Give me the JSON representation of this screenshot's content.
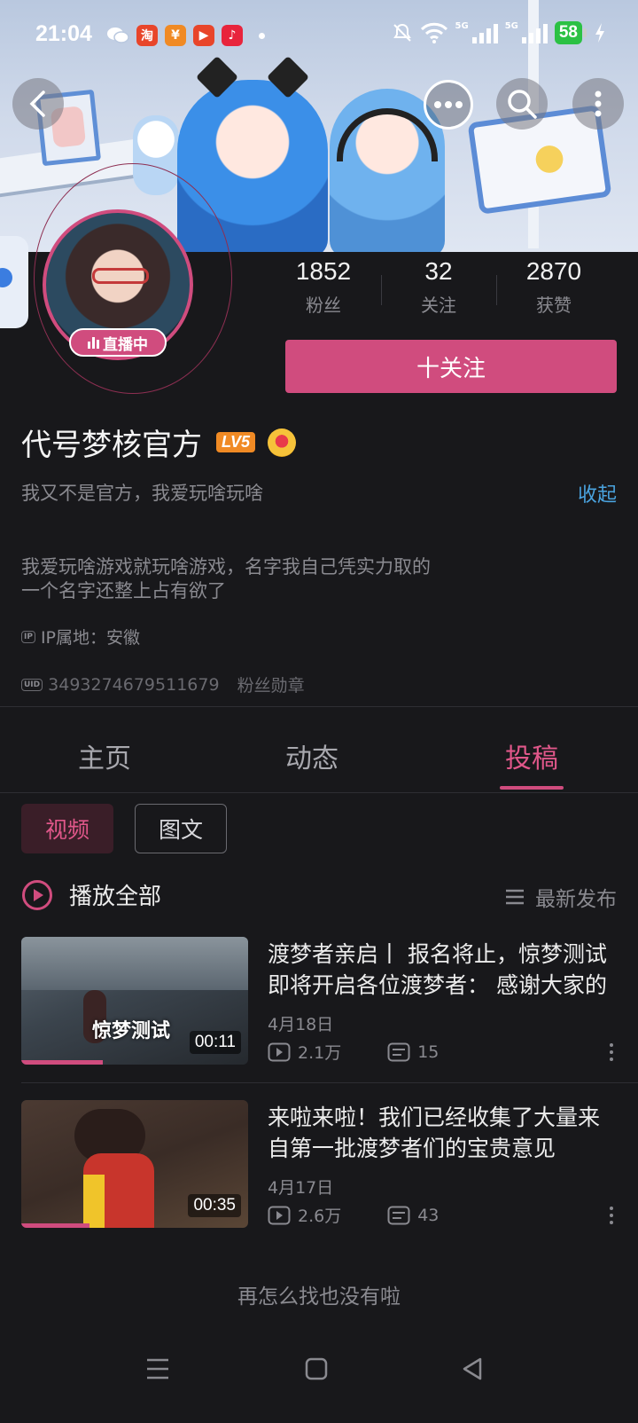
{
  "status_bar": {
    "time": "21:04",
    "battery": "58",
    "network_1": "5G",
    "network_2": "5G"
  },
  "profile": {
    "live_badge": "直播中",
    "stats": [
      {
        "value": "1852",
        "label": "粉丝"
      },
      {
        "value": "32",
        "label": "关注"
      },
      {
        "value": "2870",
        "label": "获赞"
      }
    ],
    "follow_button": "十关注",
    "name": "代号梦核官方",
    "level": "LV5",
    "signature": "我又不是官方，我爱玩啥玩啥",
    "collapse_label": "收起",
    "bio_line1": "我爱玩啥游戏就玩啥游戏，名字我自己凭实力取的",
    "bio_line2": "一个名字还整上占有欲了",
    "ip_tag": "IP",
    "ip_location": "IP属地：安徽",
    "uid_tag": "UID",
    "uid": "3493274679511679",
    "fan_medal": "粉丝勋章"
  },
  "tabs": [
    {
      "label": "主页"
    },
    {
      "label": "动态"
    },
    {
      "label": "投稿"
    }
  ],
  "filters": [
    {
      "label": "视频"
    },
    {
      "label": "图文"
    }
  ],
  "list_header": {
    "play_all": "播放全部",
    "sort": "最新发布"
  },
  "videos": [
    {
      "title": "渡梦者亲启丨 报名将止，惊梦测试即将开启各位渡梦者： 感谢大家的关注",
      "thumb_caption": "惊梦测试",
      "duration": "00:11",
      "progress": 0.36,
      "date": "4月18日",
      "plays": "2.1万",
      "comments": "15"
    },
    {
      "title": "来啦来啦！我们已经收集了大量来自第一批渡梦者们的宝贵意见",
      "thumb_caption": "",
      "duration": "00:35",
      "progress": 0.3,
      "date": "4月17日",
      "plays": "2.6万",
      "comments": "43"
    }
  ],
  "end_text": "再怎么找也没有啦",
  "colors": {
    "accent": "#d04c7e",
    "background": "#18181b",
    "link": "#4aa3df"
  }
}
